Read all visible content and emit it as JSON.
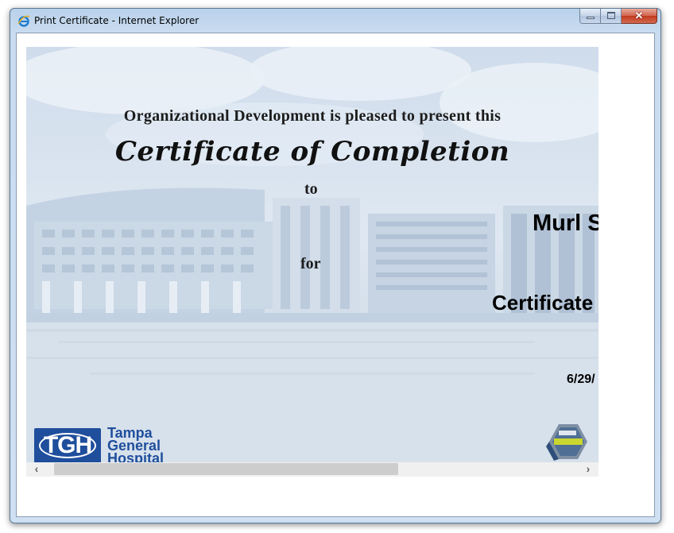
{
  "window": {
    "title": "Print Certificate - Internet Explorer",
    "close_glyph": "✕"
  },
  "certificate": {
    "presents_line": "Organizational Development is pleased to present this",
    "title": "Certificate of Completion",
    "to_word": "to",
    "recipient_name": "Murl S",
    "for_word": "for",
    "course_name": "Certificate",
    "date": "6/29/"
  },
  "logo": {
    "abbrev": "TGH",
    "line1": "Tampa",
    "line2": "General",
    "line3": "Hospital"
  },
  "scrollbar": {
    "left_arrow": "‹",
    "right_arrow": "›"
  },
  "colors": {
    "logo_blue": "#1f4e9c",
    "background_tint": "#dde6f0",
    "titlebar": "#c9dcf0"
  }
}
